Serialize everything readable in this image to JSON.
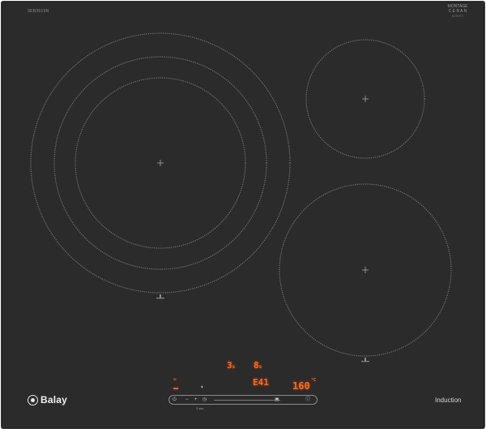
{
  "product": {
    "model_code": "3EB3519N",
    "certification_badge": [
      "MONTAGE",
      "C E R A N"
    ],
    "certification_small": "SCHOTT",
    "brand": "Balay",
    "technology_label": "Induction"
  },
  "zones": [
    {
      "name": "front-left-triple-zone",
      "rings": 3
    },
    {
      "name": "rear-right-zone",
      "rings": 1
    },
    {
      "name": "front-right-zone",
      "rings": 1
    }
  ],
  "display": {
    "zone_left_level": "3",
    "zone_left_sub": "s",
    "zone_right_level": "8",
    "zone_right_sub": "s",
    "timer_display": "E41",
    "temperature_display": "160",
    "temperature_unit": "°C"
  },
  "controls": {
    "power_icon": "power-icon",
    "minus_icon": "minus-icon",
    "plus_icon": "plus-icon",
    "timer_icon": "timer-icon",
    "lock_icon": "lock-icon",
    "info_icon": "info-icon",
    "caption": "3 sec"
  },
  "colors": {
    "glass": "#2b2b2c",
    "led": "#ff6a1a",
    "ring": "#6c6c6d"
  }
}
